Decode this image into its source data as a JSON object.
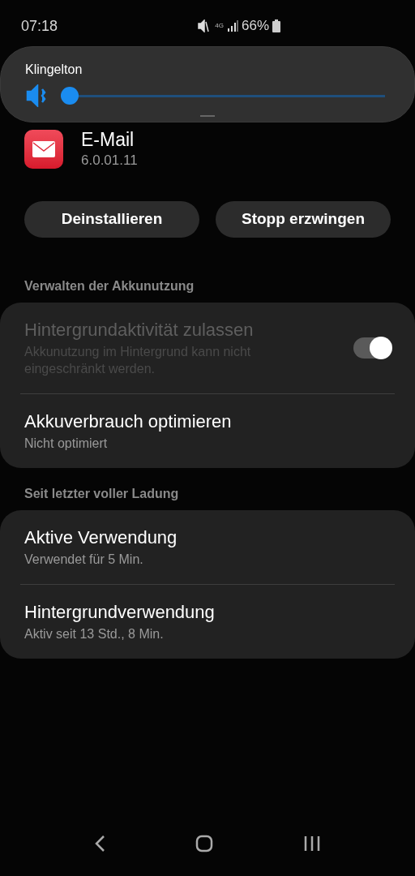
{
  "status_bar": {
    "time": "07:18",
    "battery": "66%",
    "network": "4G"
  },
  "volume_panel": {
    "label": "Klingelton",
    "muted": true,
    "level": 0.0
  },
  "app": {
    "name": "E-Mail",
    "version": "6.0.01.11"
  },
  "buttons": [
    "Deinstallieren",
    "Stopp erzwingen"
  ],
  "sections": [
    {
      "title": "Verwalten der Akkunutzung",
      "items": [
        {
          "kind": "toggle",
          "title": "Hintergrundaktivität zulassen",
          "subtitle": "Akkunutzung im Hintergrund kann nicht eingeschränkt werden.",
          "disabled": true,
          "on": true
        },
        {
          "kind": "text",
          "title": "Akkuverbrauch optimieren",
          "subtitle": "Nicht optimiert",
          "disabled": false
        }
      ]
    },
    {
      "title": "Seit letzter voller Ladung",
      "items": [
        {
          "kind": "text",
          "title": "Aktive Verwendung",
          "subtitle": "Verwendet für 5 Min.",
          "disabled": false
        },
        {
          "kind": "text",
          "title": "Hintergrundverwendung",
          "subtitle": "Aktiv seit 13 Std., 8 Min.",
          "disabled": false
        }
      ]
    }
  ]
}
